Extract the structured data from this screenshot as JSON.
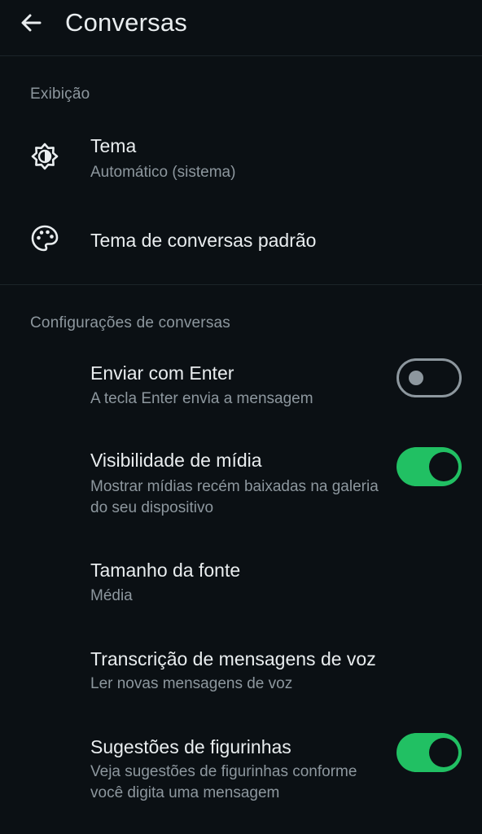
{
  "appbar": {
    "title": "Conversas",
    "back_icon": "arrow-left-icon"
  },
  "sections": {
    "display": {
      "header": "Exibição",
      "theme": {
        "title": "Tema",
        "subtitle": "Automático (sistema)",
        "icon": "brightness-auto-icon"
      },
      "chat_theme": {
        "title": "Tema de conversas padrão",
        "icon": "palette-icon"
      }
    },
    "chat_settings": {
      "header": "Configurações de conversas",
      "enter_send": {
        "title": "Enviar com Enter",
        "subtitle": "A tecla Enter envia a mensagem",
        "enabled": false
      },
      "media_visibility": {
        "title": "Visibilidade de mídia",
        "subtitle": "Mostrar mídias recém baixadas na galeria do seu dispositivo",
        "enabled": true
      },
      "font_size": {
        "title": "Tamanho da fonte",
        "subtitle": "Média"
      },
      "voice_transcription": {
        "title": "Transcrição de mensagens de voz",
        "subtitle": "Ler novas mensagens de voz"
      },
      "sticker_suggestions": {
        "title": "Sugestões de figurinhas",
        "subtitle": "Veja sugestões de figurinhas conforme você digita uma mensagem",
        "enabled": true
      }
    }
  },
  "colors": {
    "background": "#0b1014",
    "text_primary": "#e9edef",
    "text_secondary": "#8d979e",
    "accent_green": "#21c063",
    "divider": "#1c2429"
  }
}
